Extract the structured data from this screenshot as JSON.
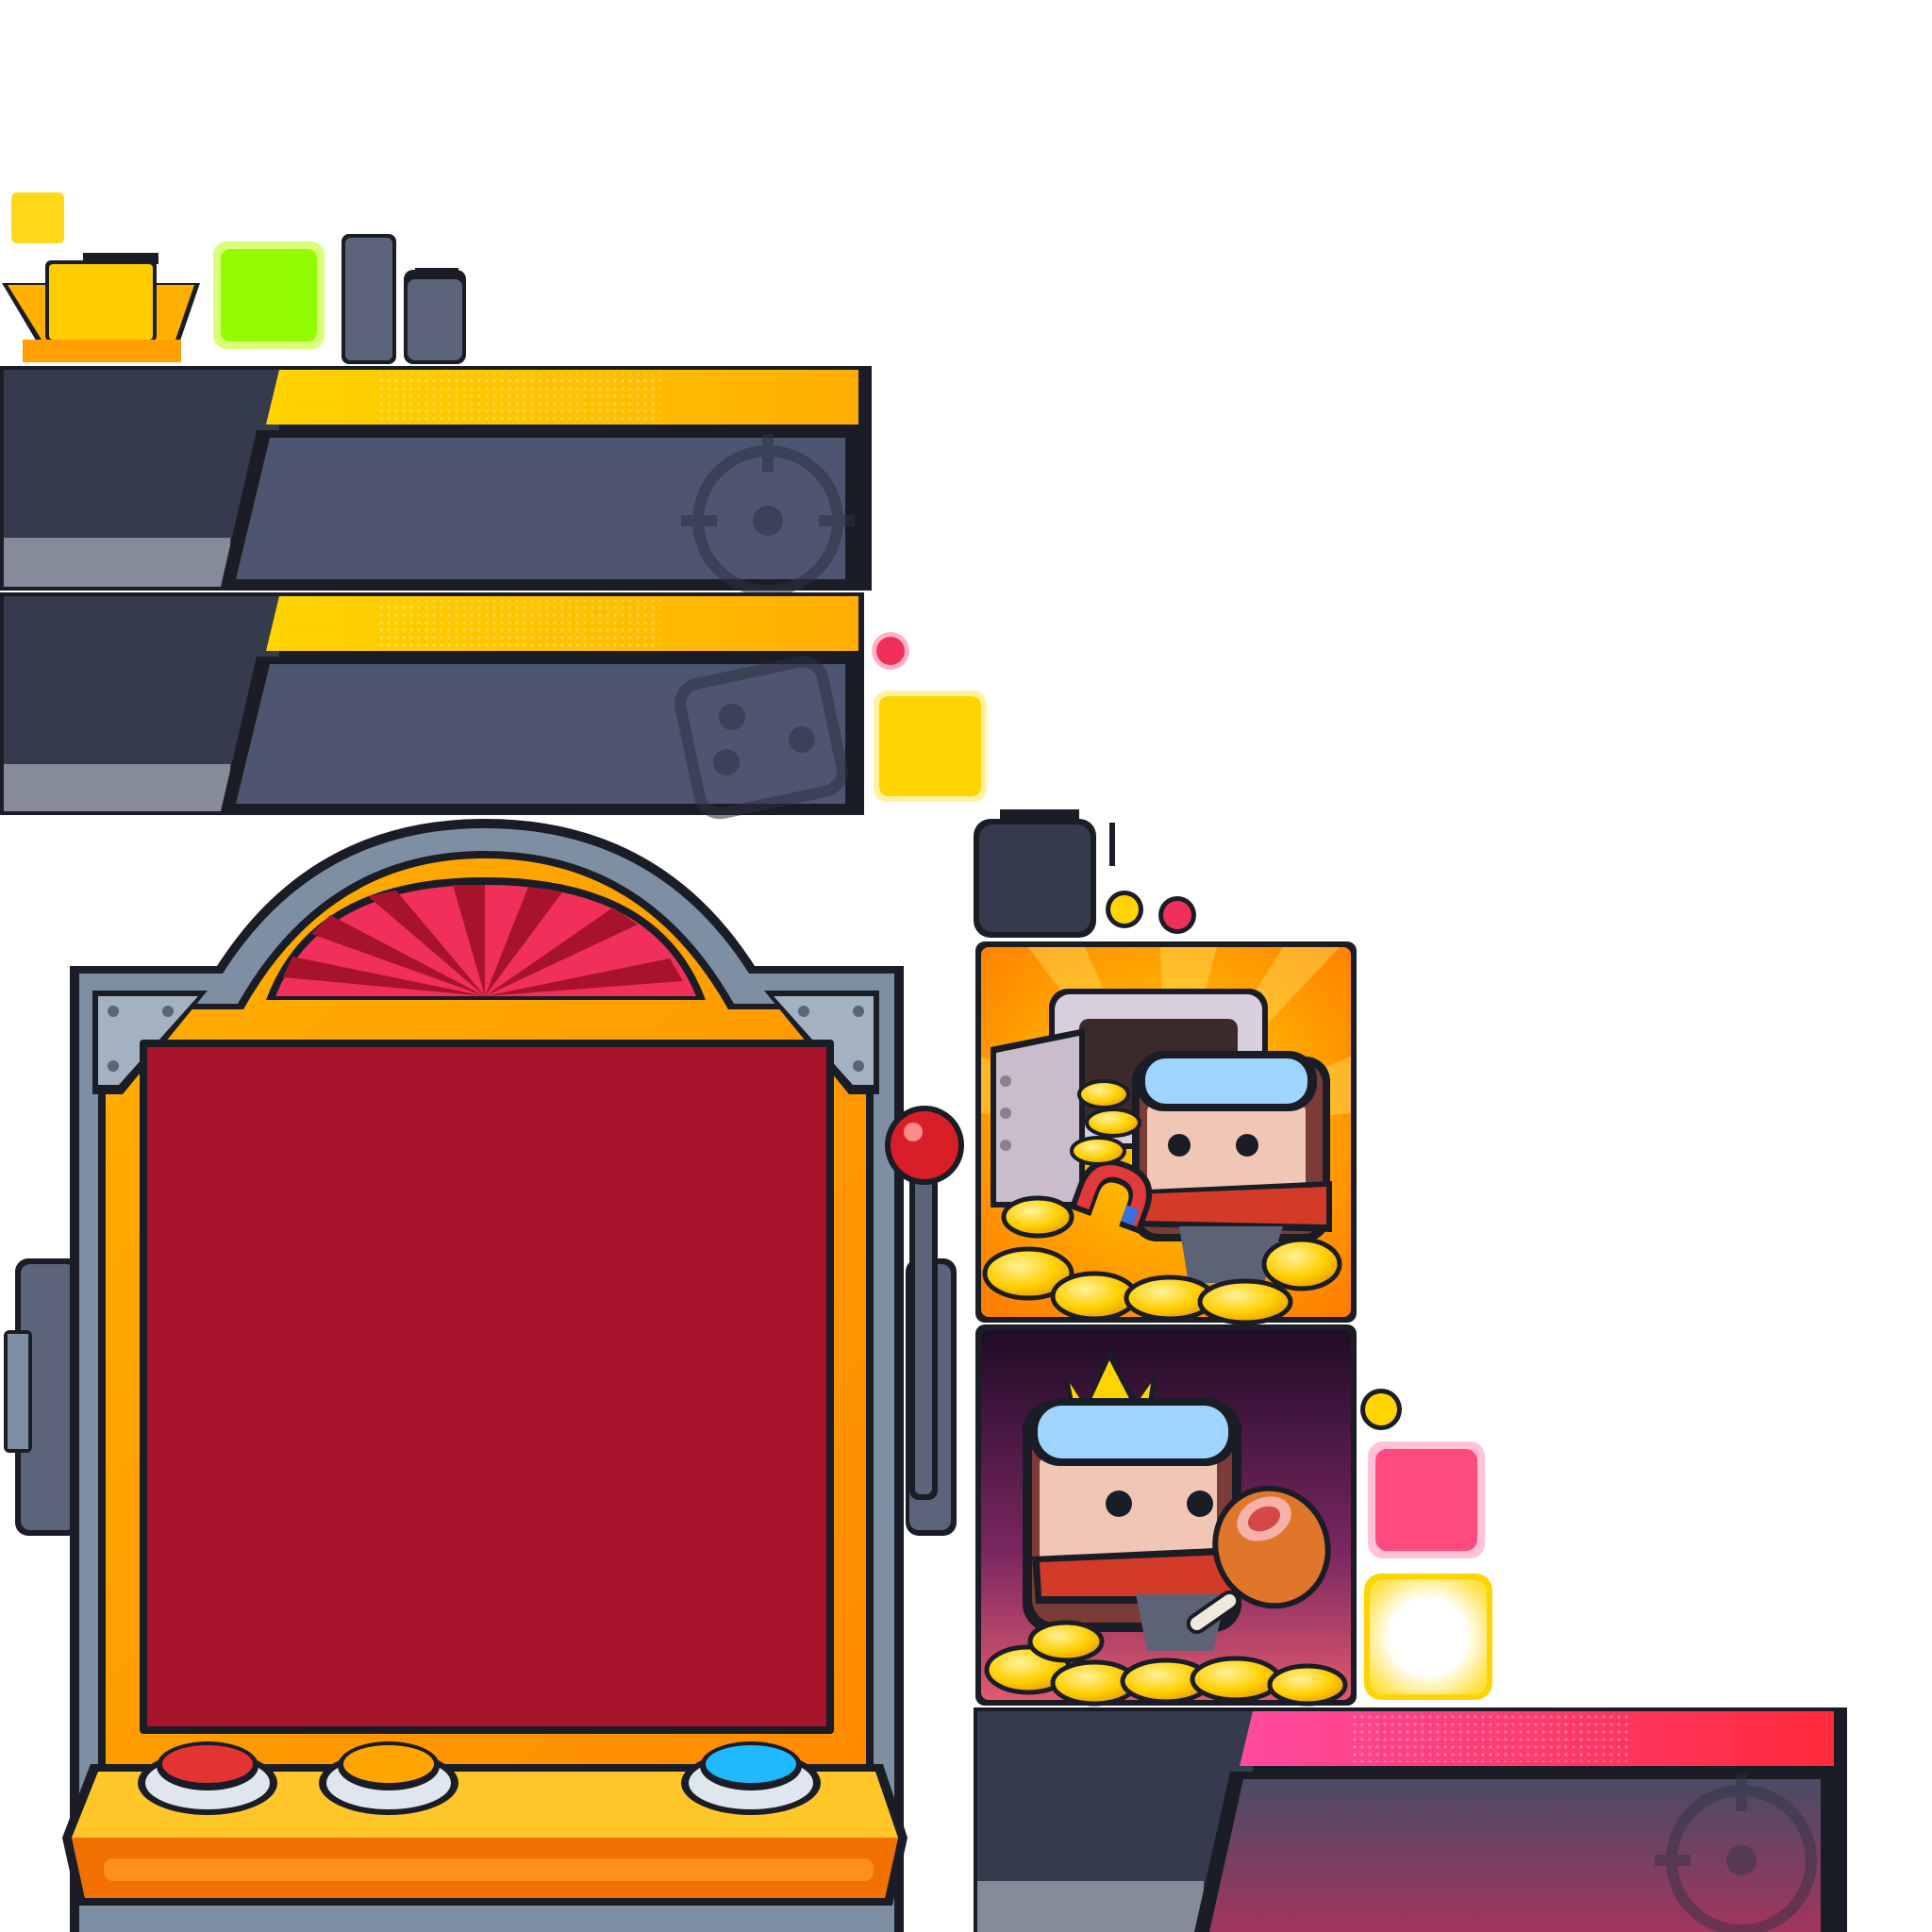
{
  "colors": {
    "outline": "#1b1d26",
    "panel_dark": "#353a4d",
    "panel_mid": "#4d5571",
    "panel_grey": "#858b99",
    "gold": "#ffd400",
    "gold_deep": "#ffae00",
    "lime": "#92fb00",
    "pink": "#ff4a80",
    "pink_deep": "#ff2a3a",
    "red_screen": "#a8132c",
    "arcade_orange": "#ff9800",
    "arcade_gold": "#ffbc00",
    "steel": "#7f8fa3",
    "white": "#ffffff"
  },
  "sprites": {
    "crown_icon": "crown-icon",
    "banner_gold_target": "target-icon",
    "banner_gold_dice": "dice-icon",
    "banner_pink_target": "target-icon",
    "card_vault": "vault-coins-magnet-character",
    "card_king": "crowned-character-meat-coins",
    "slot_machine": "arcade-slot-machine",
    "slot_buttons": [
      "red-button",
      "orange-button",
      "blue-button"
    ]
  }
}
